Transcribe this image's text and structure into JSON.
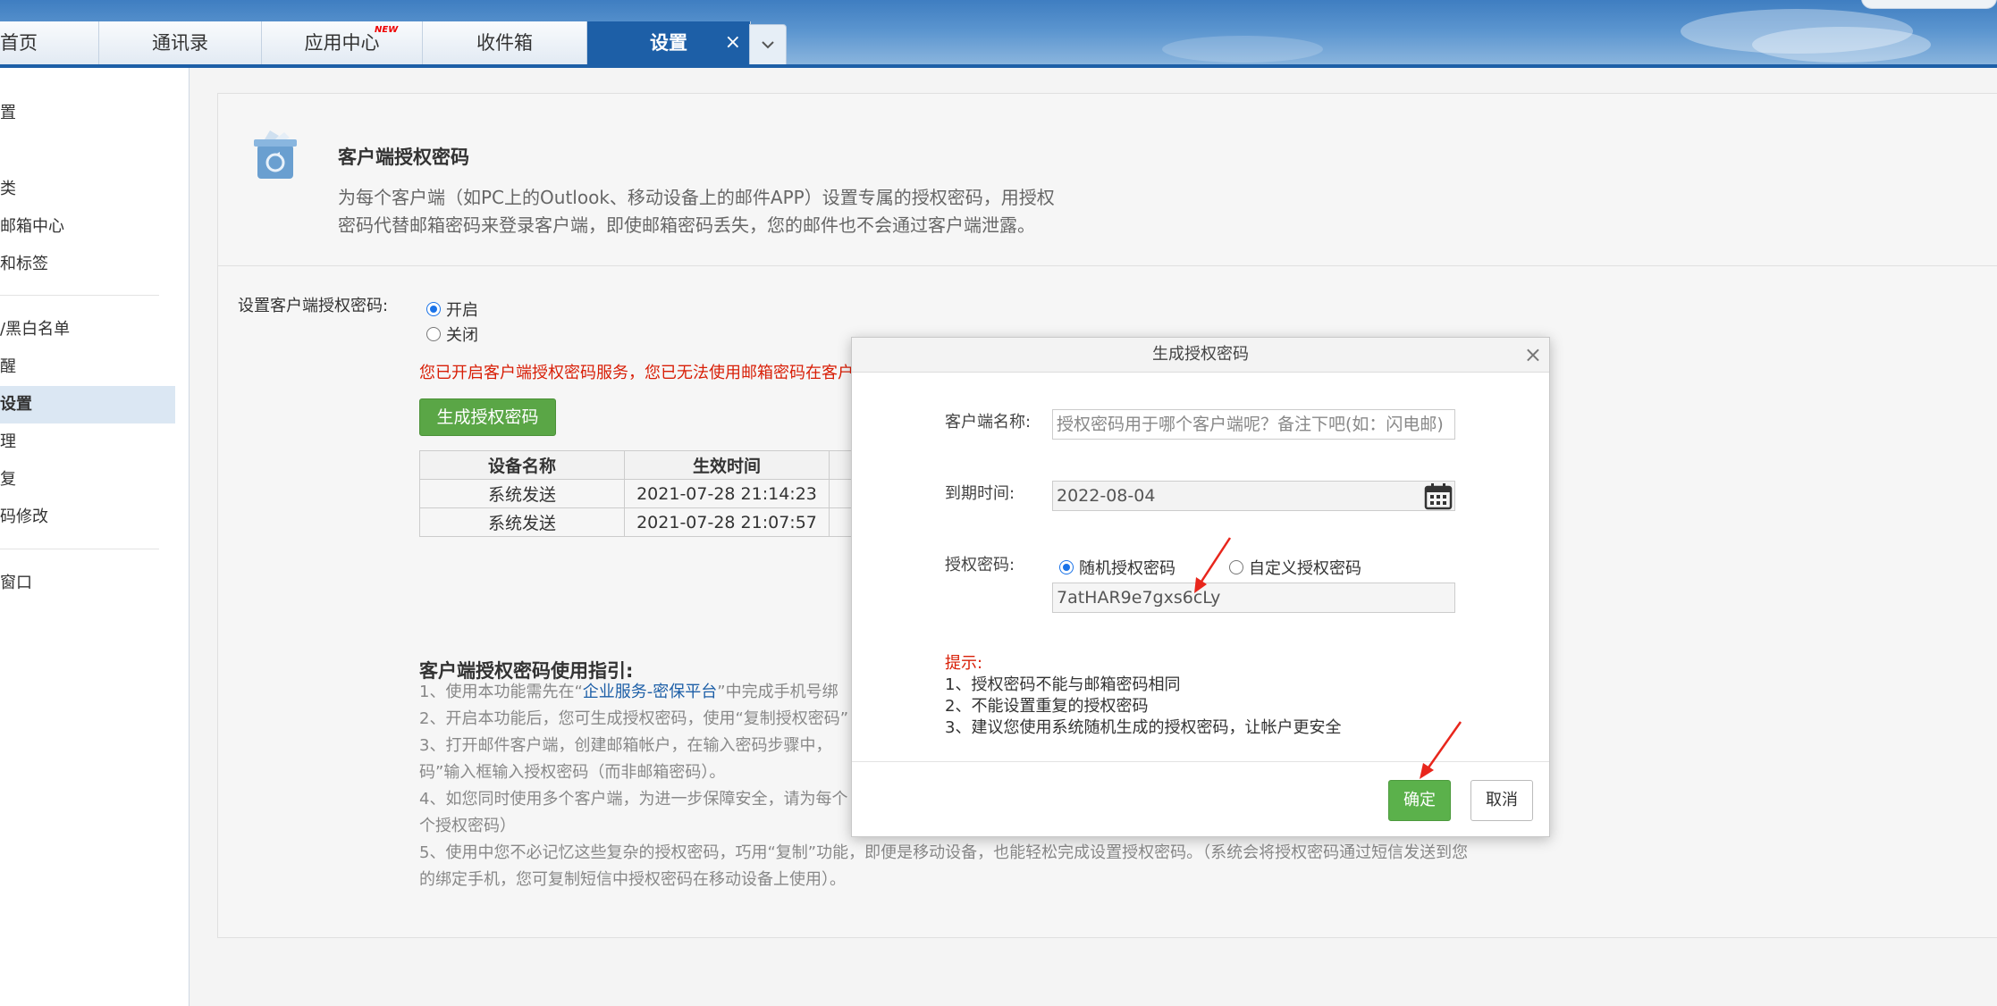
{
  "tabs": [
    {
      "label": "首页"
    },
    {
      "label": "通讯录"
    },
    {
      "label": "应用中心",
      "badge": "NEW"
    },
    {
      "label": "收件箱"
    },
    {
      "label": "设置",
      "close": "×"
    }
  ],
  "tab_more_icon": "chevron-down-icon",
  "sidebar": {
    "items": [
      {
        "label": "置"
      },
      {
        "label": "类"
      },
      {
        "label": "邮箱中心"
      },
      {
        "label": "和标签"
      },
      {
        "label": "/黑白名单"
      },
      {
        "label": "醒"
      },
      {
        "label": "设置"
      },
      {
        "label": "理"
      },
      {
        "label": "复"
      },
      {
        "label": "码修改"
      },
      {
        "label": "窗口"
      }
    ]
  },
  "intro": {
    "title": "客户端授权密码",
    "description_line1": "为每个客户端（如PC上的Outlook、移动设备上的邮件APP）设置专属的授权密码，用授权",
    "description_line2": "密码代替邮箱密码来登录客户端，即使邮箱密码丢失，您的邮件也不会通过客户端泄露。"
  },
  "setting": {
    "label": "设置客户端授权密码:",
    "option_on": "开启",
    "option_off": "关闭",
    "warning": "您已开启客户端授权密码服务，您已无法使用邮箱密码在客户",
    "generate_button": "生成授权密码"
  },
  "device_table": {
    "headers": [
      "设备名称",
      "生效时间",
      ""
    ],
    "rows": [
      [
        "系统发送",
        "2021-07-28 21:14:23",
        ""
      ],
      [
        "系统发送",
        "2021-07-28 21:07:57",
        ""
      ]
    ]
  },
  "guide": {
    "title": "客户端授权密码使用指引:",
    "line1_prefix": "1、使用本功能需先在“",
    "line1_link": "企业服务-密保平台",
    "line1_suffix": "”中完成手机号绑",
    "line2": "2、开启本功能后，您可生成授权密码，使用“复制授权密码”",
    "line3": "3、打开邮件客户端，创建邮箱帐户，在输入密码步骤中，",
    "line4": "码”输入框输入授权密码（而非邮箱密码）。",
    "line5": "4、如您同时使用多个客户端，为进一步保障安全，请为每个",
    "line6": "个授权密码）",
    "line7": "5、使用中您不必记忆这些复杂的授权密码，巧用“复制”功能，即便是移动设备，也能轻松完成设置授权密码。（系统会将授权密码通过短信发送到您",
    "line8": "的绑定手机，您可复制短信中授权密码在移动设备上使用）。"
  },
  "modal": {
    "title": "生成授权密码",
    "close": "×",
    "client_name_label": "客户端名称:",
    "client_name_placeholder": "授权密码用于哪个客户端呢？备注下吧(如：闪电邮)",
    "expire_label": "到期时间:",
    "expire_value": "2022-08-04",
    "password_label": "授权密码:",
    "option_random": "随机授权密码",
    "option_custom": "自定义授权密码",
    "password_value": "7atHAR9e7gxs6cLy",
    "tips_title": "提示:",
    "tip1": "1、授权密码不能与邮箱密码相同",
    "tip2": "2、不能设置重复的授权密码",
    "tip3": "3、建议您使用系统随机生成的授权密码，让帐户更安全",
    "ok": "确定",
    "cancel": "取消"
  },
  "colors": {
    "accent_blue": "#1d5fa7",
    "green_button": "#5bb14b",
    "warning_red": "#d81e06",
    "annotation_arrow": "#e8261c"
  }
}
